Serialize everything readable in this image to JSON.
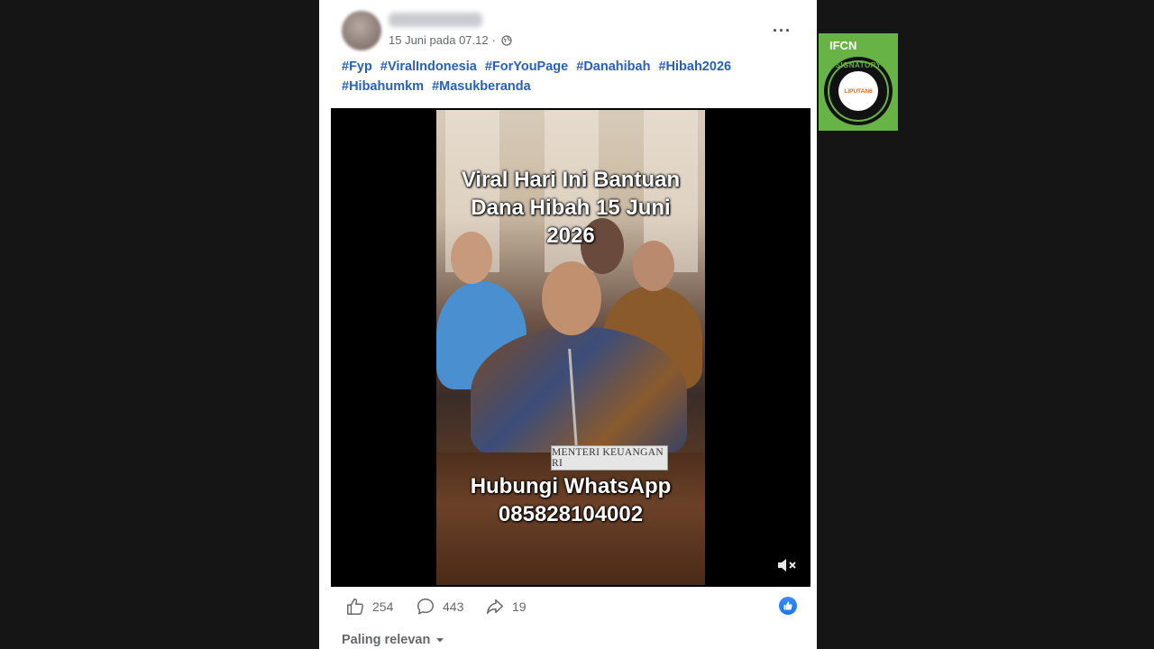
{
  "post": {
    "timestamp": "15 Juni pada 07.12",
    "separator": "·",
    "more_label": "···",
    "hashtags": [
      "#Fyp",
      "#ViralIndonesia",
      "#ForYouPage",
      "#Danahibah",
      "#Hibah2026",
      "#Hibahumkm",
      "#Masukberanda"
    ]
  },
  "video": {
    "top_line1": "Viral Hari Ini Bantuan",
    "top_line2": "Dana Hibah 15 Juni",
    "top_line3": "2026",
    "nameplate": "MENTERI KEUANGAN RI",
    "bottom_line1": "Hubungi WhatsApp",
    "bottom_line2": "085828104002"
  },
  "actions": {
    "likes": "254",
    "comments": "443",
    "shares": "19"
  },
  "comments_sort": {
    "label": "Paling relevan"
  },
  "badge": {
    "brand": "IFCN",
    "seal_word": "SIGNATORY",
    "outlet": "LIPUTAN6"
  },
  "colors": {
    "hashtag": "#2a5fb8",
    "like_badge": "#1877f2",
    "badge_green": "#68b345"
  }
}
